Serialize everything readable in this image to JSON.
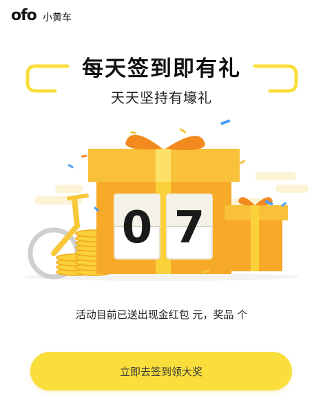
{
  "header": {
    "logo_text": "ofo",
    "brand_text": "小黄车"
  },
  "hero": {
    "title": "每天签到即有礼",
    "subtitle": "天天坚持有壕礼",
    "counter_digits": [
      "0",
      "7"
    ]
  },
  "stats": {
    "text": "活动目前已送出现金红包 元，奖品 个"
  },
  "cta": {
    "label": "立即去签到领大奖"
  },
  "colors": {
    "accent_yellow": "#f9de3c",
    "gift_orange": "#f7a928",
    "gift_dark_orange": "#f28a1e"
  },
  "icons": [
    "gift-box",
    "flip-counter",
    "bicycle",
    "coin-stack",
    "confetti",
    "cloud"
  ]
}
